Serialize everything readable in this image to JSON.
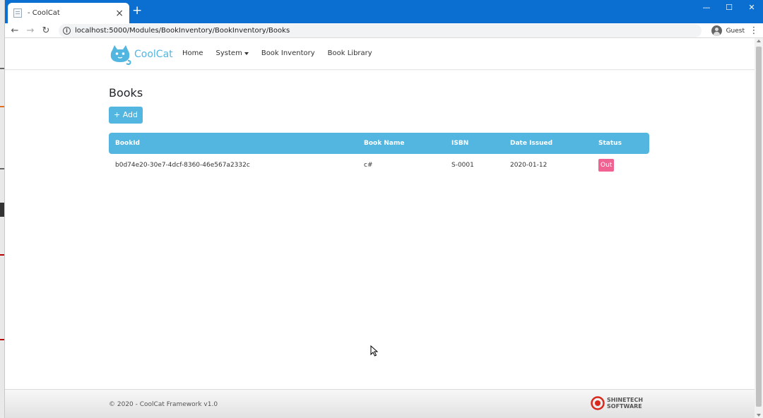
{
  "browser": {
    "tab_title": "- CoolCat",
    "url": "localhost:5000/Modules/BookInventory/BookInventory/Books",
    "profile_name": "Guest"
  },
  "app": {
    "brand": "CoolCat",
    "nav": {
      "home": "Home",
      "system": "System",
      "book_inventory": "Book Inventory",
      "book_library": "Book Library"
    }
  },
  "page": {
    "title": "Books",
    "add_label": "+ Add"
  },
  "table": {
    "headers": [
      "BookId",
      "Book Name",
      "ISBN",
      "Date Issued",
      "Status"
    ],
    "rows": [
      {
        "book_id": "b0d74e20-30e7-4dcf-8360-46e567a2332c",
        "book_name": "c#",
        "isbn": "S-0001",
        "date_issued": "2020-01-12",
        "status": "Out"
      }
    ]
  },
  "footer": {
    "copyright": "© 2020 - CoolCat Framework v1.0",
    "company_line1": "SHINETECH",
    "company_line2": "SOFTWARE"
  },
  "colors": {
    "chrome_titlebar": "#0a6fd1",
    "accent": "#52b6e0",
    "status_out": "#f06292"
  }
}
